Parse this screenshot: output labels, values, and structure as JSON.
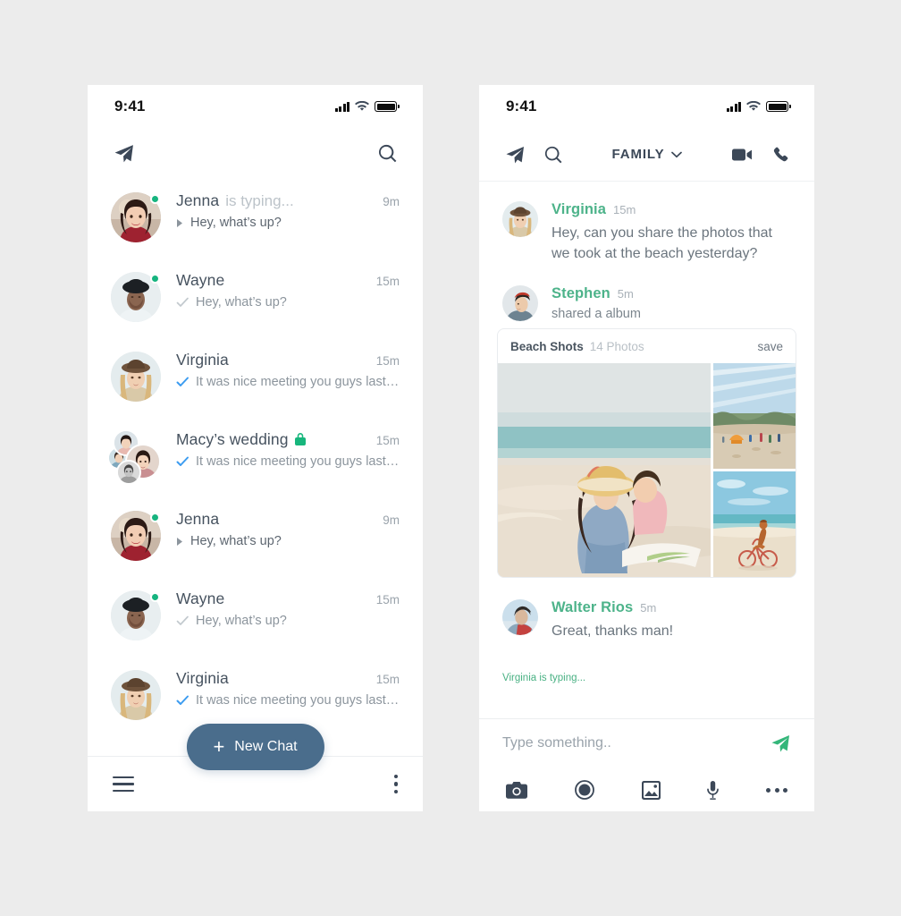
{
  "theme": {
    "page_background": "#ececec",
    "accent_green": "#4db38a",
    "accent_blue_button": "#4a6d8c",
    "online_dot": "#16b47f",
    "tick_read": "#3c9cf0",
    "tick_sent": "#c2c9ce"
  },
  "list_screen": {
    "status": {
      "time": "9:41",
      "signal_icon": "signal-bars-icon",
      "wifi_icon": "wifi-icon",
      "battery_icon": "battery-icon"
    },
    "nav": {
      "send_icon": "paper-plane-icon",
      "search_icon": "search-icon"
    },
    "rows": [
      {
        "name": "Jenna",
        "typing": "is typing...",
        "time": "9m",
        "preview": "Hey, what’s up?",
        "marker": "reply-arrow",
        "online": true,
        "locked": false,
        "avatar": "woman-red-top",
        "group": false
      },
      {
        "name": "Wayne",
        "typing": "",
        "time": "15m",
        "preview": "Hey, what’s up?",
        "marker": "tick-sent",
        "online": true,
        "locked": false,
        "avatar": "man-black-hat",
        "group": false
      },
      {
        "name": "Virginia",
        "typing": "",
        "time": "15m",
        "preview": "It was nice meeting you guys last ...",
        "marker": "tick-read",
        "online": false,
        "locked": false,
        "avatar": "woman-brown-hat",
        "group": false
      },
      {
        "name": "Macy’s wedding",
        "typing": "",
        "time": "15m",
        "preview": "It was nice meeting you guys last ...",
        "marker": "tick-read",
        "online": false,
        "locked": true,
        "avatar": "group-stack",
        "group": true
      },
      {
        "name": "Jenna",
        "typing": "",
        "time": "9m",
        "preview": "Hey, what’s up?",
        "marker": "reply-arrow",
        "online": true,
        "locked": false,
        "avatar": "woman-red-top",
        "group": false
      },
      {
        "name": "Wayne",
        "typing": "",
        "time": "15m",
        "preview": "Hey, what’s up?",
        "marker": "tick-sent",
        "online": true,
        "locked": false,
        "avatar": "man-black-hat",
        "group": false
      },
      {
        "name": "Virginia",
        "typing": "",
        "time": "15m",
        "preview": "It was nice meeting you guys last ...",
        "marker": "tick-read",
        "online": false,
        "locked": false,
        "avatar": "woman-brown-hat",
        "group": false
      }
    ],
    "bottom": {
      "menu_icon": "hamburger-menu-icon",
      "new_chat_label": "New Chat",
      "new_chat_plus": "+",
      "more_icon": "kebab-menu-icon"
    }
  },
  "chat_screen": {
    "status": {
      "time": "9:41",
      "signal_icon": "signal-bars-icon",
      "wifi_icon": "wifi-icon",
      "battery_icon": "battery-icon"
    },
    "nav": {
      "send_icon": "paper-plane-icon",
      "search_icon": "search-icon",
      "title": "FAMILY",
      "chevron_icon": "chevron-down-icon",
      "video_icon": "video-camera-icon",
      "call_icon": "phone-icon"
    },
    "messages": [
      {
        "name": "Virginia",
        "time": "15m",
        "text": "Hey, can you share the photos that we took at the beach yesterday?",
        "meta": "",
        "avatar": "woman-brown-hat"
      },
      {
        "name": "Stephen",
        "time": "5m",
        "text": "",
        "meta": "shared a album",
        "avatar": "man-red-bandana"
      },
      {
        "name": "Walter Rios",
        "time": "5m",
        "text": "Great, thanks man!",
        "meta": "",
        "avatar": "man-blue-jacket"
      }
    ],
    "album": {
      "title": "Beach Shots",
      "count": "14 Photos",
      "save_label": "save",
      "photos": [
        {
          "name": "beach-mother-and-child",
          "layout": "big"
        },
        {
          "name": "beach-crowd-aerial",
          "layout": "small"
        },
        {
          "name": "beach-cyclist",
          "layout": "small"
        }
      ]
    },
    "typing_hint": "Virginia is typing...",
    "composer": {
      "placeholder": "Type something..",
      "value": "",
      "send_icon": "send-plane-icon",
      "tools": [
        "camera-icon",
        "record-circle-icon",
        "photo-gallery-icon",
        "microphone-icon",
        "more-dots-icon"
      ]
    }
  }
}
